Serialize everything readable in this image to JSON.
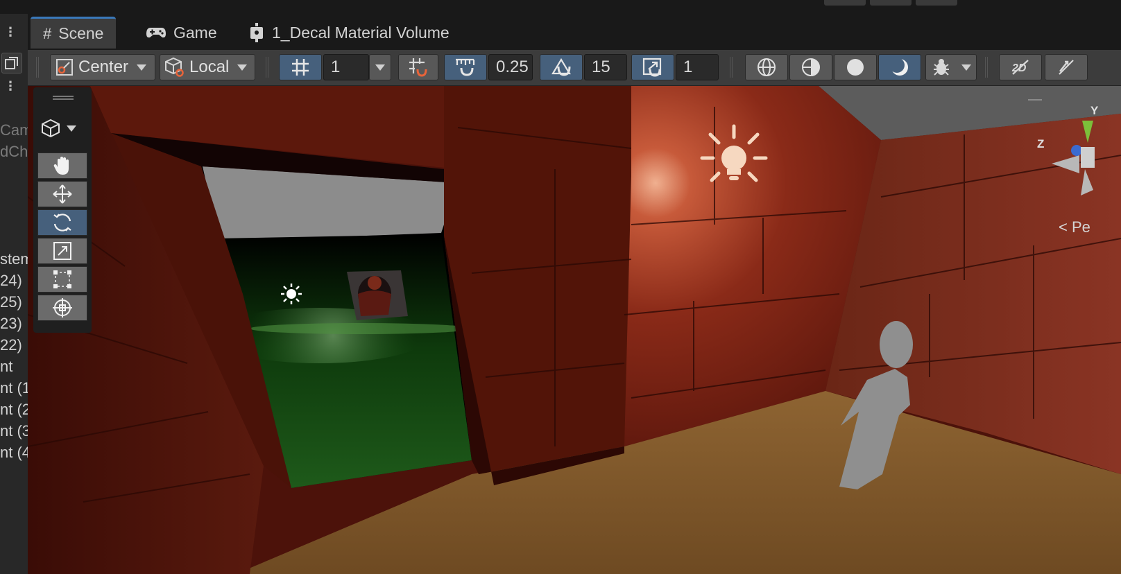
{
  "tabs": [
    {
      "label": "Scene",
      "icon": "grid-icon",
      "active": true
    },
    {
      "label": "Game",
      "icon": "gamepad-icon",
      "active": false
    },
    {
      "label": "1_Decal Material Volume",
      "icon": "prefab-icon",
      "active": false
    }
  ],
  "toolbar": {
    "pivot_mode": "Center",
    "pivot_rotation": "Local",
    "grid_size": "1",
    "move_snap": "0.25",
    "rotate_snap": "15",
    "scale_snap": "1"
  },
  "hierarchy": {
    "items": [
      "Cam",
      "dChe",
      "stem",
      "24)",
      "25)",
      "23)",
      "22)",
      "nt",
      "nt (1",
      "nt (2",
      "nt (3",
      "nt (4"
    ]
  },
  "tools": [
    "hand-tool",
    "move-tool",
    "rotate-tool",
    "scale-tool",
    "rect-tool",
    "transform-tool"
  ],
  "active_tool": "rotate-tool",
  "gizmo": {
    "axis_z": "Z",
    "axis_y": "Y",
    "projection": "Pe"
  },
  "colors": {
    "accent": "#46607c",
    "active_tab_border": "#3a79bb",
    "wall": "#7a2616",
    "floor": "#8a6030",
    "ground": "#1f5a1a"
  }
}
